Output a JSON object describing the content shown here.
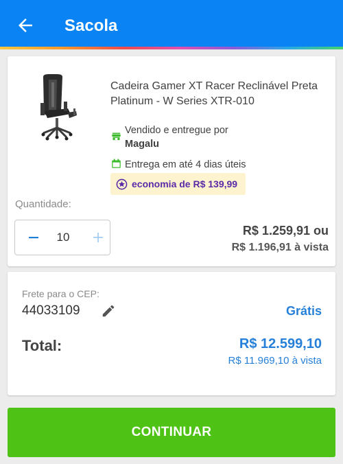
{
  "header": {
    "title": "Sacola",
    "back_icon": "arrow-left-icon",
    "background_color": "#0a84f5"
  },
  "product": {
    "name": "Cadeira Gamer XT Racer Reclinável Preta Platinum - W Series XTR-010",
    "image_icon": "gaming-chair-image",
    "seller_label": "Vendido e entregue por",
    "seller_name": "Magalu",
    "delivery": "Entrega em até 4 dias úteis",
    "economy": "economia de R$ 139,99",
    "quantity_label": "Quantidade:",
    "quantity": "10",
    "price_installment": "R$ 1.259,91 ou",
    "price_cash": "R$ 1.196,91 à vista"
  },
  "shipping": {
    "cep_label": "Frete para o CEP:",
    "cep": "44033109",
    "price": "Grátis"
  },
  "total": {
    "label": "Total:",
    "value": "R$ 12.599,10",
    "cash": "R$ 11.969,10 à vista"
  },
  "actions": {
    "continue_label": "CONTINUAR",
    "continue_color": "#4ec215"
  },
  "colors": {
    "accent_blue": "#2680d9",
    "seller_green": "#3dbb2c",
    "economy_purple": "#5a2aa8",
    "economy_bg": "#fdf3cf"
  }
}
